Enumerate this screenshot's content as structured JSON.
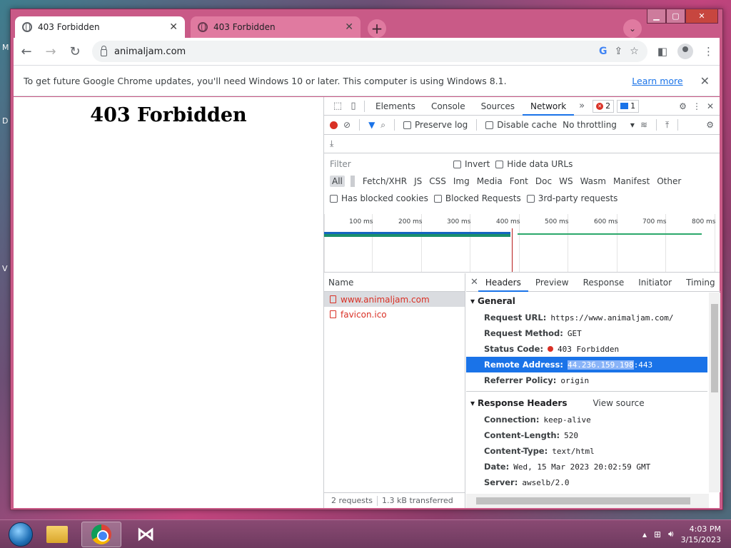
{
  "desktop": {
    "side_letters": [
      "M",
      "D",
      "V"
    ]
  },
  "tabs": [
    {
      "title": "403 Forbidden",
      "active": true
    },
    {
      "title": "403 Forbidden",
      "active": false
    }
  ],
  "toolbar": {
    "url": "animaljam.com"
  },
  "infobar": {
    "message": "To get future Google Chrome updates, you'll need Windows 10 or later. This computer is using Windows 8.1.",
    "link": "Learn more"
  },
  "page": {
    "heading": "403 Forbidden"
  },
  "devtools": {
    "tabs": [
      "Elements",
      "Console",
      "Sources",
      "Network"
    ],
    "active_tab": "Network",
    "errors_count": "2",
    "messages_count": "1",
    "controls": {
      "preserve_log": "Preserve log",
      "disable_cache": "Disable cache",
      "throttling": "No throttling"
    },
    "filter": {
      "placeholder": "Filter",
      "invert": "Invert",
      "hide_data_urls": "Hide data URLs",
      "types": [
        "All",
        "Fetch/XHR",
        "JS",
        "CSS",
        "Img",
        "Media",
        "Font",
        "Doc",
        "WS",
        "Wasm",
        "Manifest",
        "Other"
      ],
      "has_blocked_cookies": "Has blocked cookies",
      "blocked_requests": "Blocked Requests",
      "third_party": "3rd-party requests"
    },
    "timeline_labels": [
      "100 ms",
      "200 ms",
      "300 ms",
      "400 ms",
      "500 ms",
      "600 ms",
      "700 ms",
      "800 ms"
    ],
    "requests": {
      "header": "Name",
      "items": [
        "www.animaljam.com",
        "favicon.ico"
      ],
      "footer": {
        "count": "2 requests",
        "transferred": "1.3 kB transferred"
      }
    },
    "details": {
      "tabs": [
        "Headers",
        "Preview",
        "Response",
        "Initiator",
        "Timing"
      ],
      "general": {
        "title": "General",
        "rows": [
          {
            "k": "Request URL:",
            "v": "https://www.animaljam.com/"
          },
          {
            "k": "Request Method:",
            "v": "GET"
          },
          {
            "k": "Status Code:",
            "v": "403 Forbidden"
          },
          {
            "k": "Remote Address:",
            "v_sel": "44.236.159.198",
            "v_rest": ":443"
          },
          {
            "k": "Referrer Policy:",
            "v": "origin"
          }
        ]
      },
      "response_headers": {
        "title": "Response Headers",
        "view_source": "View source",
        "rows": [
          {
            "k": "Connection:",
            "v": "keep-alive"
          },
          {
            "k": "Content-Length:",
            "v": "520"
          },
          {
            "k": "Content-Type:",
            "v": "text/html"
          },
          {
            "k": "Date:",
            "v": "Wed, 15 Mar 2023 20:02:59 GMT"
          },
          {
            "k": "Server:",
            "v": "awselb/2.0"
          }
        ]
      }
    }
  },
  "taskbar": {
    "time": "4:03 PM",
    "date": "3/15/2023"
  }
}
